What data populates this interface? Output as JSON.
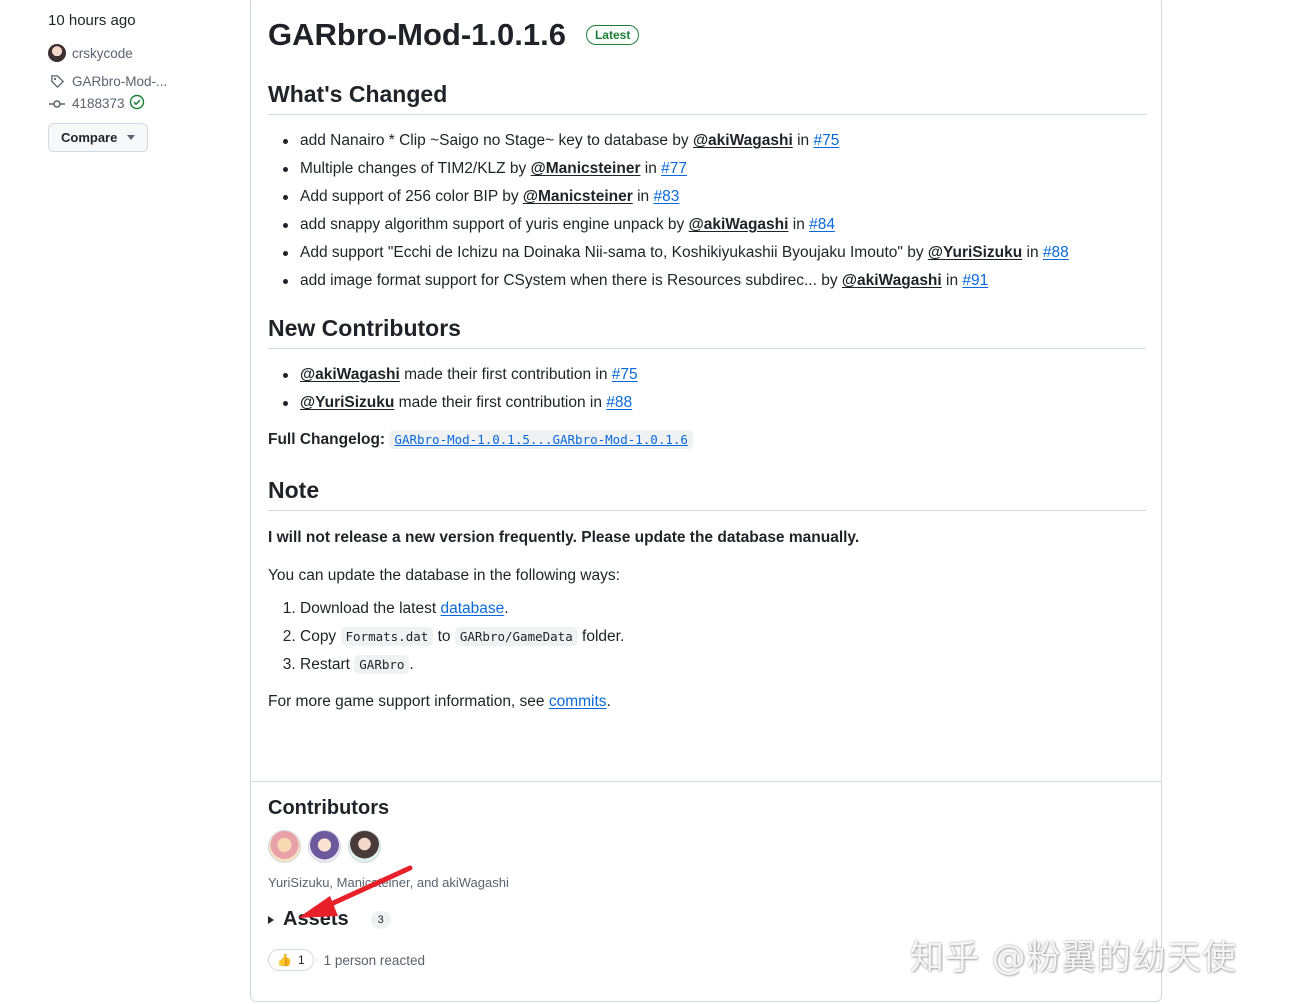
{
  "sidebar": {
    "time": "10 hours ago",
    "author": "crskycode",
    "tag": "GARbro-Mod-...",
    "commit": "4188373",
    "compare_label": "Compare"
  },
  "release": {
    "title": "GARbro-Mod-1.0.1.6",
    "badge": "Latest",
    "whats_changed": {
      "heading": "What's Changed",
      "items": [
        {
          "text": "add Nanairo * Clip ~Saigo no Stage~ key to database by ",
          "user": "@akiWagashi",
          "in": " in ",
          "pr": "#75"
        },
        {
          "text": "Multiple changes of TIM2/KLZ by ",
          "user": "@Manicsteiner",
          "in": " in ",
          "pr": "#77"
        },
        {
          "text": "Add support of 256 color BIP by ",
          "user": "@Manicsteiner",
          "in": " in ",
          "pr": "#83"
        },
        {
          "text": "add snappy algorithm support of yuris engine unpack by ",
          "user": "@akiWagashi",
          "in": " in ",
          "pr": "#84"
        },
        {
          "text": "Add support \"Ecchi de Ichizu na Doinaka Nii-sama to, Koshikiyukashii Byoujaku Imouto\" by ",
          "user": "@YuriSizuku",
          "in": " in ",
          "pr": "#88"
        },
        {
          "text": "add image format support for CSystem when there is Resources subdirec... by ",
          "user": "@akiWagashi",
          "in": " in ",
          "pr": "#91"
        }
      ]
    },
    "new_contributors": {
      "heading": "New Contributors",
      "items": [
        {
          "user": "@akiWagashi",
          "text": " made their first contribution in ",
          "pr": "#75"
        },
        {
          "user": "@YuriSizuku",
          "text": " made their first contribution in ",
          "pr": "#88"
        }
      ]
    },
    "changelog": {
      "label": "Full Changelog:",
      "link": "GARbro-Mod-1.0.1.5...GARbro-Mod-1.0.1.6"
    },
    "note": {
      "heading": "Note",
      "bold_line": "I will not release a new version frequently. Please update the database manually.",
      "intro": "You can update the database in the following ways:",
      "step1_pre": "Download the latest ",
      "step1_link": "database",
      "step1_post": ".",
      "step2_pre": "Copy ",
      "step2_code1": "Formats.dat",
      "step2_mid": " to ",
      "step2_code2": "GARbro/GameData",
      "step2_post": " folder.",
      "step3_pre": "Restart ",
      "step3_code": "GARbro",
      "step3_post": ".",
      "more_pre": "For more game support information, see ",
      "more_link": "commits",
      "more_post": "."
    }
  },
  "footer": {
    "contributors_heading": "Contributors",
    "contributors_names": "YuriSizuku, Manicsteiner, and akiWagashi",
    "assets_label": "Assets",
    "assets_count": "3",
    "reaction_emoji": "👍",
    "reaction_count": "1",
    "reaction_text": "1 person reacted"
  },
  "watermark": "知乎 @粉翼的幼天使",
  "colors": {
    "link": "#0969da",
    "green": "#1a7f37",
    "arrow": "#e8202a",
    "border": "#d1d9e0"
  }
}
